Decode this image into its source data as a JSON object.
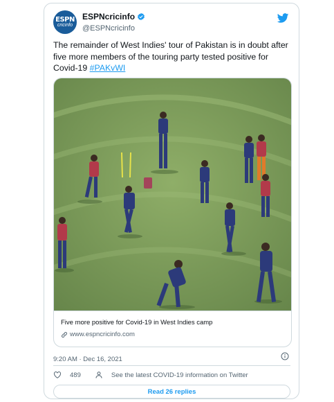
{
  "author": {
    "display_name": "ESPNcricinfo",
    "handle": "@ESPNcricinfo",
    "avatar_logo_top": "ESPN",
    "avatar_logo_bottom": "cricinfo",
    "verified": true
  },
  "tweet": {
    "text": "The remainder of West Indies' tour of Pakistan is in doubt after five more members of the touring party tested positive for Covid-19 ",
    "hashtag": "#PAKvWI"
  },
  "link_card": {
    "title": "Five more positive for Covid-19 in West Indies camp",
    "domain": "www.espncricinfo.com"
  },
  "meta": {
    "timestamp": "9:20 AM · Dec 16, 2021"
  },
  "actions": {
    "like_count": "489",
    "info_text": "See the latest COVID-19 information on Twitter"
  },
  "replies_button": {
    "label": "Read 26 replies"
  },
  "icons": [
    "verified-icon",
    "twitter-bird-icon",
    "link-icon",
    "info-icon",
    "heart-icon",
    "person-icon"
  ],
  "colors": {
    "accent": "#1d9bf0",
    "text": "#0f1419",
    "secondary": "#536471",
    "border": "#cfd9de",
    "avatar_bg": "#1a5c9a",
    "field_green": "#7e9d5a",
    "kit_blue": "#2c3a7a",
    "kit_red": "#b23a4a"
  }
}
